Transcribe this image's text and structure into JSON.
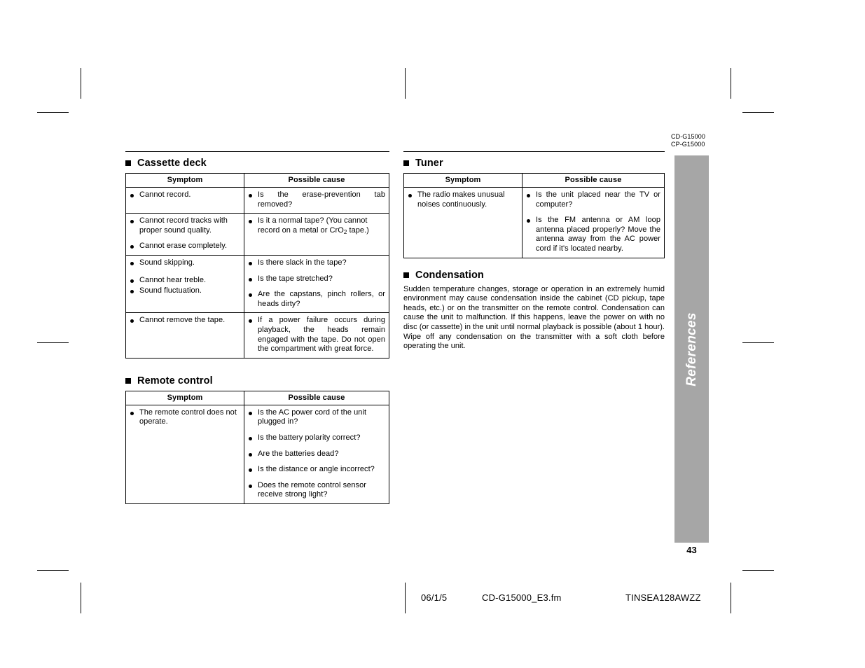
{
  "header": {
    "model_1": "CD-G15000",
    "model_2": "CP-G15000"
  },
  "sidebar": {
    "tab_label": "References",
    "page_number": "43"
  },
  "columns": {
    "left": {
      "sections": [
        {
          "title": "Cassette deck",
          "table": {
            "headers": [
              "Symptom",
              "Possible cause"
            ],
            "rows": [
              {
                "symptom": [
                  "Cannot record."
                ],
                "cause": [
                  "Is the erase-prevention tab removed?"
                ]
              },
              {
                "symptom": [
                  "Cannot record tracks with proper sound quality.",
                  "Cannot erase completely."
                ],
                "cause": [
                  "Is it a normal tape? (You cannot record on a metal or CrO2 tape.)"
                ]
              },
              {
                "symptom": [
                  "Sound skipping.",
                  "Cannot hear treble.",
                  "Sound fluctuation."
                ],
                "cause": [
                  "Is there slack in the tape?",
                  "Is the tape stretched?",
                  "Are the capstans, pinch rollers, or heads dirty?"
                ]
              },
              {
                "symptom": [
                  "Cannot remove the tape."
                ],
                "cause": [
                  "If a power failure occurs during playback, the heads remain engaged with the tape. Do not open the compartment with great force."
                ]
              }
            ]
          }
        },
        {
          "title": "Remote control",
          "table": {
            "headers": [
              "Symptom",
              "Possible cause"
            ],
            "rows": [
              {
                "symptom": [
                  "The remote control does not operate."
                ],
                "cause": [
                  "Is the AC power cord of the unit plugged in?",
                  "Is the battery polarity correct?",
                  "Are the batteries dead?",
                  "Is the distance or angle incorrect?",
                  "Does the remote control sensor receive strong light?"
                ]
              }
            ]
          }
        }
      ]
    },
    "right": {
      "sections": [
        {
          "title": "Tuner",
          "table": {
            "headers": [
              "Symptom",
              "Possible cause"
            ],
            "rows": [
              {
                "symptom": [
                  "The radio makes unusual noises continuously."
                ],
                "cause": [
                  "Is the unit placed near the TV or computer?",
                  "Is the FM antenna or AM loop antenna placed properly? Move the antenna away from the AC power cord if it's located nearby."
                ]
              }
            ]
          }
        },
        {
          "title": "Condensation",
          "paragraph": "Sudden temperature changes, storage or operation in an extremely humid environment may cause condensation inside the cabinet (CD pickup, tape heads, etc.) or on the transmitter on the remote control. Condensation can cause the unit to malfunction. If this happens, leave the power on with no disc (or cassette) in the unit until normal playback is possible (about 1 hour). Wipe off any condensation on the transmitter with a soft cloth before operating the unit."
        }
      ]
    }
  },
  "footer": {
    "date": "06/1/5",
    "file_name": "CD-G15000_E3.fm",
    "doc_code": "TINSEA128AWZZ"
  }
}
